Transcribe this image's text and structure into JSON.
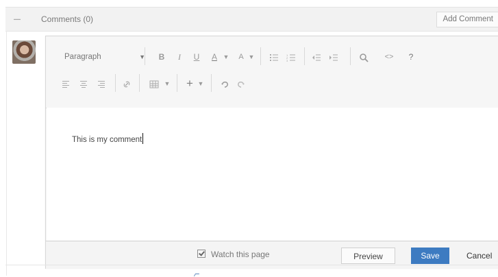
{
  "header": {
    "title": "Comments (0)",
    "add_comment_label": "Add Comment"
  },
  "editor": {
    "paragraph_label": "Paragraph",
    "toolbar_text": {
      "bold": "B",
      "italic": "I",
      "underline": "U",
      "text_color": "A",
      "more_format": "A",
      "help": "?"
    },
    "comment_text": "This is my comment",
    "footer": {
      "watch_label": "Watch this page",
      "preview_label": "Preview",
      "save_label": "Save",
      "cancel_label": "Cancel"
    }
  },
  "colors": {
    "header_bg": "#f2f2f2",
    "accent": "#3d7bc1"
  }
}
